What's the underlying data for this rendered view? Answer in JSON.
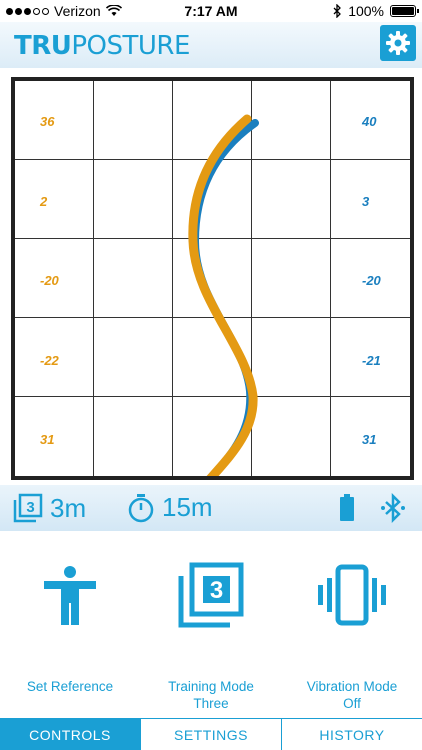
{
  "status": {
    "carrier": "Verizon",
    "time": "7:17 AM",
    "battery": "100%"
  },
  "header": {
    "logo_bold": "TRU",
    "logo_light": "POSTURE",
    "settings_icon": "gear-icon"
  },
  "grid": {
    "left_values": [
      "36",
      "2",
      "-20",
      "-22",
      "31"
    ],
    "right_values": [
      "40",
      "3",
      "-20",
      "-21",
      "31"
    ],
    "colors": {
      "reference": "#e49a13",
      "current": "#1a7fbf"
    }
  },
  "info": {
    "mode_time": "3m",
    "timer": "15m"
  },
  "controls": [
    {
      "label": "Set Reference",
      "icon": "person-arms-out-icon"
    },
    {
      "label": "Training Mode\nThree",
      "icon": "training-mode-three-icon"
    },
    {
      "label": "Vibration Mode\nOff",
      "icon": "vibration-phone-icon"
    }
  ],
  "tabs": [
    "CONTROLS",
    "SETTINGS",
    "HISTORY"
  ],
  "accent": "#1a9fd4"
}
